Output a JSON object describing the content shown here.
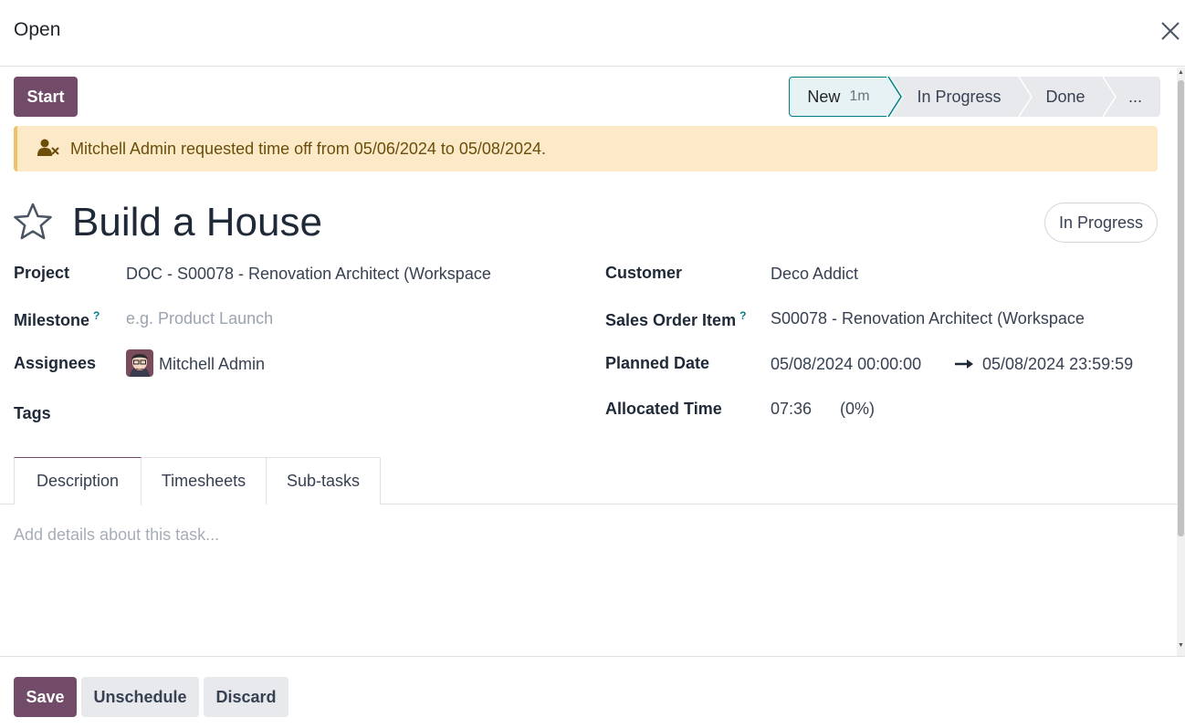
{
  "dialog": {
    "title": "Open"
  },
  "header": {
    "start_label": "Start"
  },
  "statusbar": {
    "stages": [
      {
        "label": "New",
        "duration": "1m",
        "active": true
      },
      {
        "label": "In Progress",
        "active": false
      },
      {
        "label": "Done",
        "active": false
      },
      {
        "label": "...",
        "active": false
      }
    ]
  },
  "alert": {
    "icon": "user-times-icon",
    "text": "Mitchell Admin requested time off from 05/06/2024 to 05/08/2024."
  },
  "task": {
    "title": "Build a House",
    "state": "In Progress",
    "starred": false
  },
  "fields": {
    "project": {
      "label": "Project",
      "value": "DOC - S00078 - Renovation Architect (Workspace"
    },
    "milestone": {
      "label": "Milestone",
      "help": "?",
      "placeholder": "e.g. Product Launch"
    },
    "assignees": {
      "label": "Assignees",
      "value": "Mitchell Admin"
    },
    "tags": {
      "label": "Tags"
    },
    "customer": {
      "label": "Customer",
      "value": "Deco Addict"
    },
    "sales_order_item": {
      "label": "Sales Order Item",
      "help": "?",
      "value": "S00078 - Renovation Architect (Workspace"
    },
    "planned_date": {
      "label": "Planned Date",
      "start": "05/08/2024 00:00:00",
      "end": "05/08/2024 23:59:59"
    },
    "allocated_time": {
      "label": "Allocated Time",
      "value": "07:36",
      "percent": "(0%)"
    }
  },
  "tabs": [
    {
      "label": "Description",
      "active": true
    },
    {
      "label": "Timesheets",
      "active": false
    },
    {
      "label": "Sub-tasks",
      "active": false
    }
  ],
  "description": {
    "placeholder": "Add details about this task..."
  },
  "footer": {
    "save_label": "Save",
    "unschedule_label": "Unschedule",
    "discard_label": "Discard"
  },
  "colors": {
    "primary": "#714b67",
    "accent": "#017e84",
    "alert_bg": "#fbe9c8"
  }
}
